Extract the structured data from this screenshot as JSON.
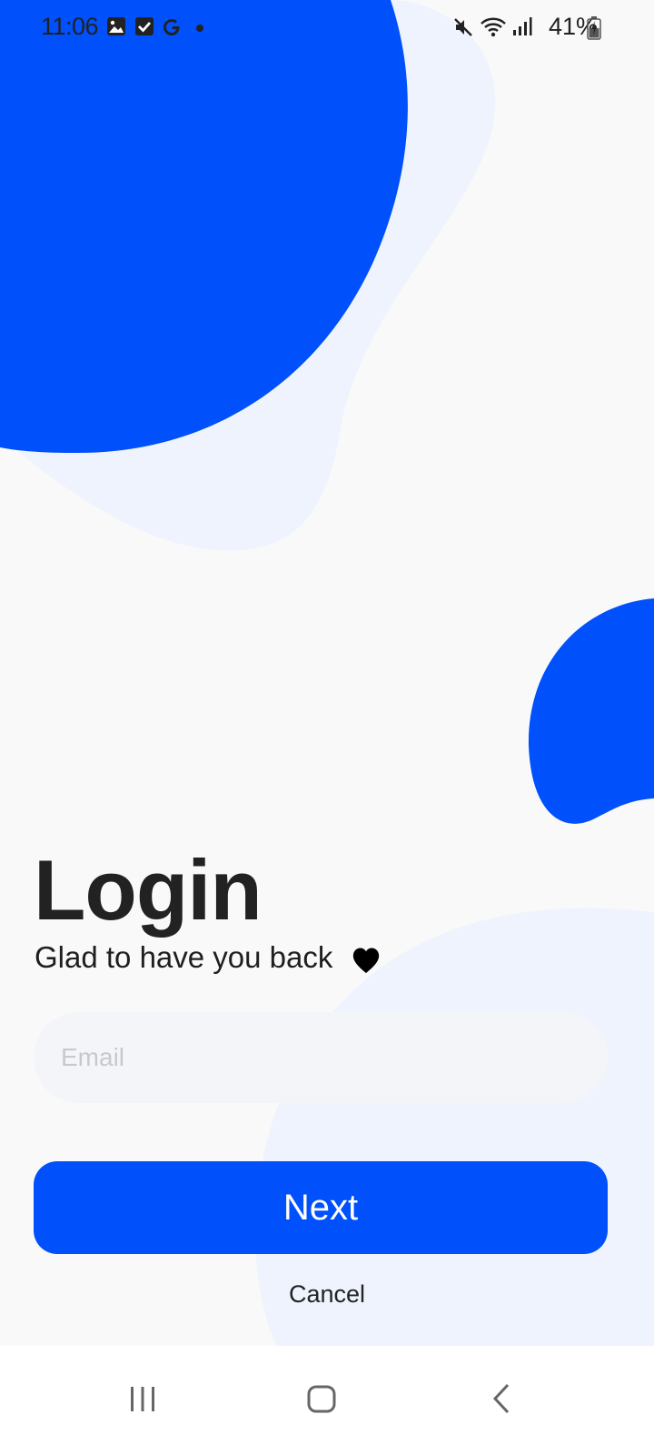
{
  "status_bar": {
    "time": "11:06",
    "battery": "41%",
    "icons": [
      "gallery-icon",
      "check-icon",
      "google-icon",
      "dot-icon",
      "mute-icon",
      "wifi-icon",
      "signal-icon",
      "battery-icon"
    ]
  },
  "login": {
    "title": "Login",
    "subtitle": "Glad to have you back",
    "subtitle_icon": "heart-icon",
    "email_placeholder": "Email",
    "next_label": "Next",
    "cancel_label": "Cancel"
  },
  "nav": {
    "icons": [
      "recents-icon",
      "home-icon",
      "back-icon"
    ]
  },
  "colors": {
    "accent": "#0050fc",
    "light_blob": "#eef3fe",
    "background": "#f9f9f9",
    "input_bg": "#f4f5f9"
  }
}
